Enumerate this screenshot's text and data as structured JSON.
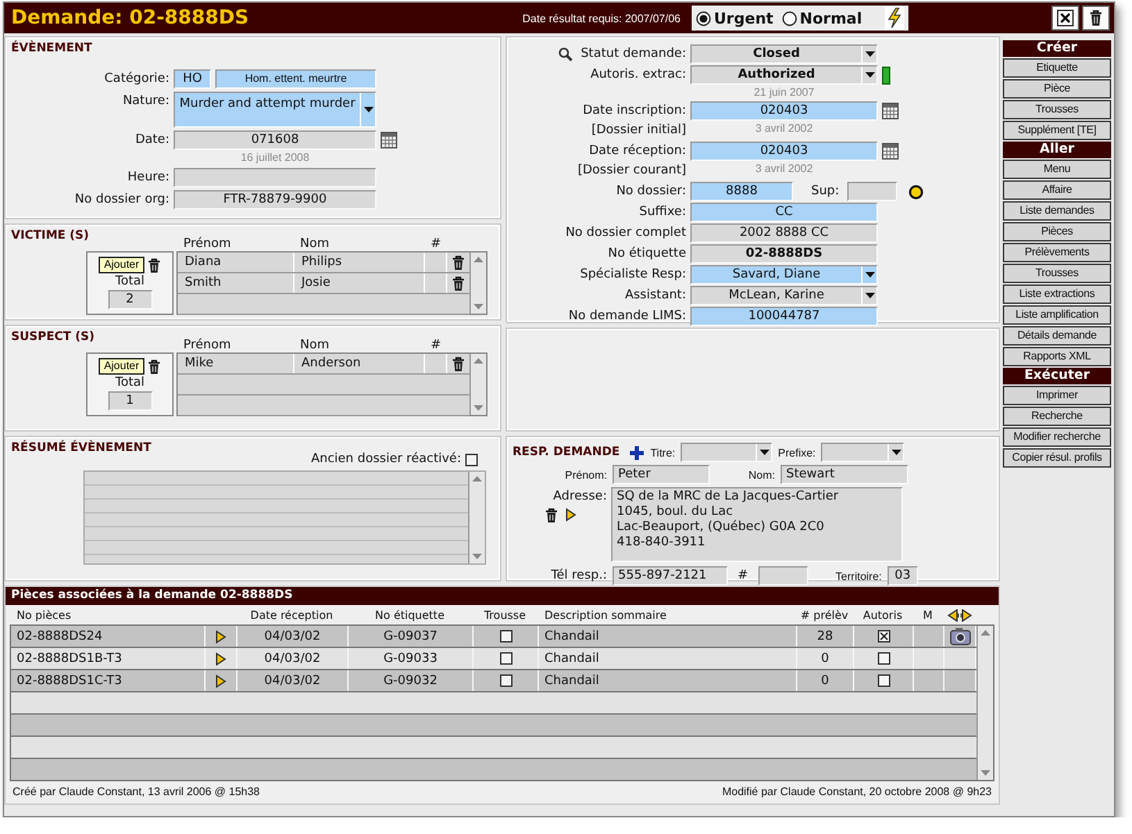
{
  "header": {
    "title": "Demande: 02-8888DS",
    "due_date": "Date résultat requis: 2007/07/06",
    "priority": [
      {
        "label": "Urgent",
        "selected": true
      },
      {
        "label": "Normal",
        "selected": false
      }
    ]
  },
  "event": {
    "title": "ÉVÈNEMENT",
    "fields": [
      {
        "kind": "pair",
        "label": "Catégorie:",
        "values": [
          "HO",
          "Hom. ettent. meurtre"
        ],
        "required": true
      },
      {
        "kind": "multiselect",
        "label": "Nature:",
        "value": "Murder and attempt murder",
        "required": true
      },
      {
        "kind": "date",
        "label": "Date:",
        "value": "071608",
        "note": "16 juillet 2008",
        "required": false
      },
      {
        "kind": "text",
        "label": "Heure:",
        "required": false
      },
      {
        "kind": "text",
        "label": "No dossier org:",
        "value": "FTR-78879-9900",
        "required": false
      }
    ]
  },
  "request": {
    "fields": [
      {
        "kind": "select",
        "label": "Statut demande:",
        "value": "Closed",
        "required": false,
        "bold": true,
        "searchable": true
      },
      {
        "kind": "select",
        "label": "Autoris. extrac:",
        "value": "Authorized",
        "required": false,
        "bold": true,
        "status_light": true,
        "note": "21 juin 2007"
      },
      {
        "kind": "date",
        "label": "Date inscription:",
        "sublabel": "[Dossier initial]",
        "value": "020403",
        "required": true,
        "note": "3 avril 2002"
      },
      {
        "kind": "date",
        "label": "Date réception:",
        "sublabel": "[Dossier courant]",
        "value": "020403",
        "required": true,
        "note": "3 avril 2002"
      },
      {
        "kind": "split",
        "label": "No dossier:",
        "value": "8888",
        "required": true,
        "extra_label": "Sup:",
        "status_dot": true
      },
      {
        "kind": "text",
        "label": "Suffixe:",
        "value": "CC",
        "required": true
      },
      {
        "kind": "text",
        "label": "No dossier complet",
        "value": "2002 8888 CC",
        "required": false
      },
      {
        "kind": "text",
        "label": "No étiquette",
        "value": "02-8888DS",
        "required": false,
        "bold": true
      },
      {
        "kind": "select",
        "label": "Spécialiste Resp:",
        "value": "Savard, Diane",
        "required": true
      },
      {
        "kind": "select",
        "label": "Assistant:",
        "value": "McLean, Karine",
        "required": false
      },
      {
        "kind": "text",
        "label": "No demande LIMS:",
        "value": "100044787",
        "required": true
      }
    ]
  },
  "victims": {
    "title": "VICTIME (S)",
    "add_button": "Ajouter",
    "total_label": "Total",
    "total": "2",
    "columns": [
      "Prénom",
      "Nom",
      "#"
    ],
    "rows": [
      {
        "first_name": "Diana",
        "last_name": "Philips"
      },
      {
        "first_name": "Smith",
        "last_name": "Josie"
      }
    ]
  },
  "suspects": {
    "title": "SUSPECT (S)",
    "add_button": "Ajouter",
    "total_label": "Total",
    "total": "1",
    "columns": [
      "Prénom",
      "Nom",
      "#"
    ],
    "rows": [
      {
        "first_name": "Mike",
        "last_name": "Anderson"
      }
    ]
  },
  "summary": {
    "title": "RÉSUMÉ ÉVÈNEMENT",
    "reactivated_label": "Ancien dossier réactivé:",
    "reactivated": false
  },
  "requester": {
    "title": "RESP. DEMANDE",
    "title_label": "Titre:",
    "prefix_label": "Prefixe:",
    "first_name_label": "Prénom:",
    "first_name": "Peter",
    "last_name_label": "Nom:",
    "last_name": "Stewart",
    "address_label": "Adresse:",
    "address": [
      "SQ de la MRC de La Jacques-Cartier",
      "1045, boul. du Lac",
      "Lac-Beauport, (Québec) G0A 2C0",
      "418-840-3911"
    ],
    "phone_label": "Tél resp.:",
    "phone": "555-897-2121",
    "ext_label": "#",
    "territory_label": "Territoire:",
    "territory": "03"
  },
  "pieces": {
    "title": "Pièces associées à la demande 02-8888DS",
    "columns": [
      "No pièces",
      "Date réception",
      "No étiquette",
      "Trousse",
      "Description sommaire",
      "# prélèv",
      "Autoris",
      "M"
    ],
    "rows": [
      {
        "number": "02-8888DS24",
        "date": "04/03/02",
        "label": "G-09037",
        "kit": false,
        "description": "Chandail",
        "samples": "28",
        "authorized": true,
        "photo": true
      },
      {
        "number": "02-8888DS1B-T3",
        "date": "04/03/02",
        "label": "G-09033",
        "kit": false,
        "description": "Chandail",
        "samples": "0",
        "authorized": false,
        "photo": false
      },
      {
        "number": "02-8888DS1C-T3",
        "date": "04/03/02",
        "label": "G-09032",
        "kit": false,
        "description": "Chandail",
        "samples": "0",
        "authorized": false,
        "photo": false
      }
    ]
  },
  "footer": {
    "created": "Créé par Claude Constant, 13 avril 2006 @ 15h38",
    "modified": "Modifié par Claude Constant, 20 octobre 2008 @ 9h23"
  },
  "sidebar": [
    {
      "title": "Créer",
      "items": [
        "Etiquette",
        "Pièce",
        "Trousses",
        "Supplément [TE]"
      ]
    },
    {
      "title": "Aller",
      "items": [
        "Menu",
        "Affaire",
        "Liste demandes",
        "Pièces",
        "Prélèvements",
        "Trousses",
        "Liste extractions",
        "Liste amplification",
        "Détails demande",
        "Rapports XML"
      ]
    },
    {
      "title": "Exécuter",
      "items": [
        "Imprimer",
        "Recherche",
        "Modifier recherche",
        "Copier résul. profils"
      ]
    }
  ]
}
